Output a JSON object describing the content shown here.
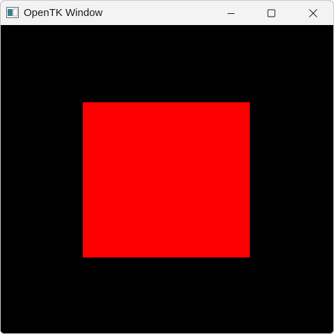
{
  "window": {
    "title": "OpenTK Window",
    "icons": {
      "app": "app-window-icon",
      "minimize": "minimize-icon",
      "maximize": "maximize-icon",
      "close": "close-icon"
    }
  },
  "scene": {
    "clear_color": "#000000",
    "shape": "quad",
    "shape_color": "#ff0000"
  }
}
